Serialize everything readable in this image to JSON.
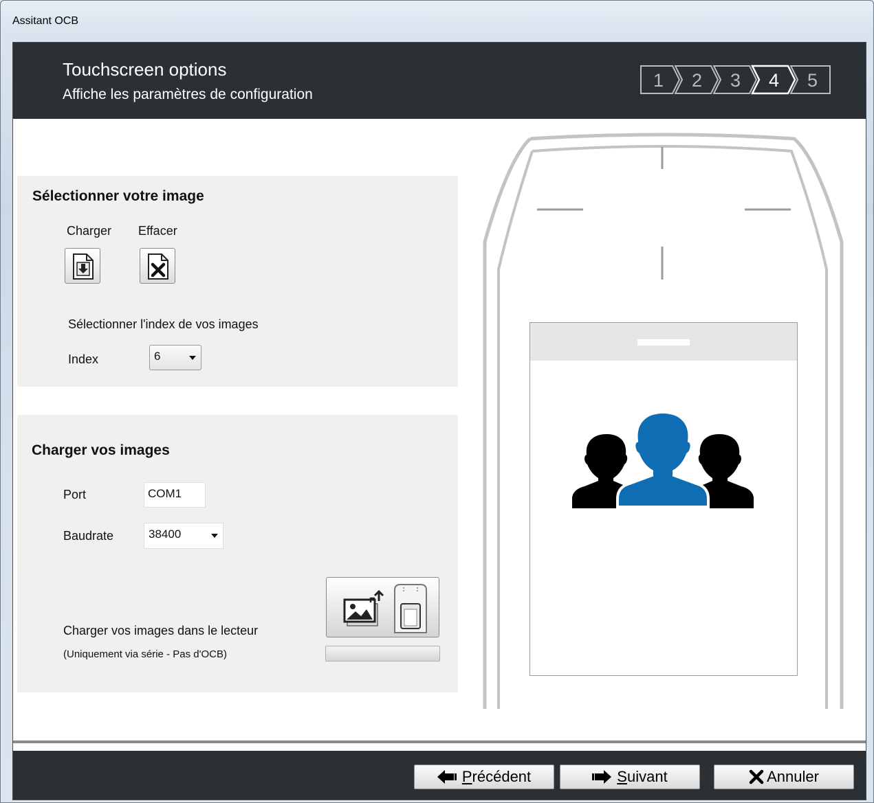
{
  "window": {
    "title": "Assitant OCB"
  },
  "header": {
    "title": "Touchscreen options",
    "subtitle": "Affiche les paramètres de configuration",
    "steps": [
      "1",
      "2",
      "3",
      "4",
      "5"
    ],
    "active_step": "4"
  },
  "select_image": {
    "title": "Sélectionner votre image",
    "load_label": "Charger",
    "clear_label": "Effacer",
    "index_prompt": "Sélectionner l'index de vos images",
    "index_label": "Index",
    "index_value": "6"
  },
  "load_images": {
    "title": "Charger vos images",
    "port_label": "Port",
    "port_value": "COM1",
    "baudrate_label": "Baudrate",
    "baudrate_value": "38400",
    "reader_label": "Charger vos images dans le lecteur",
    "reader_note": "(Uniquement via série - Pas d'OCB)",
    "progress": 0
  },
  "preview": {
    "icon": "users-group-icon",
    "accent": "#0f6db3"
  },
  "footer": {
    "prev_first": "P",
    "prev_rest": "récédent",
    "next_first": "S",
    "next_rest": "uivant",
    "cancel_label": "Annuler"
  },
  "colors": {
    "header_bg": "#2b3035",
    "panel_bg": "#f0f0f0",
    "accent_blue": "#0f6db3"
  }
}
